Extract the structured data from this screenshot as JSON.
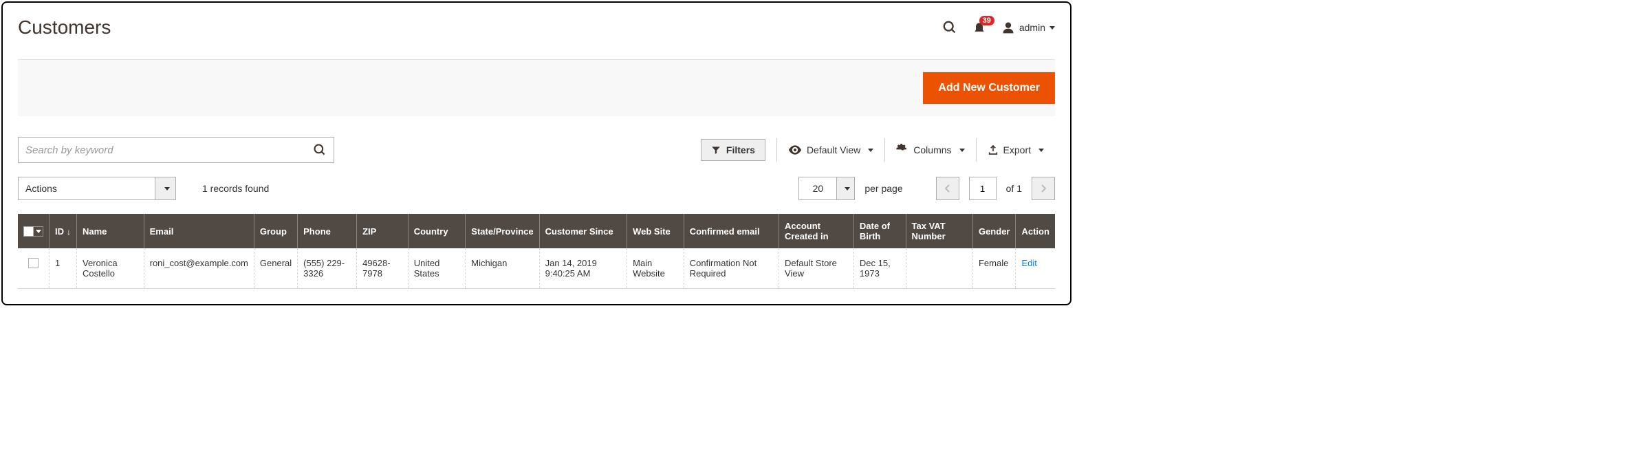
{
  "page": {
    "title": "Customers",
    "user_name": "admin",
    "notification_count": "39"
  },
  "toolbar": {
    "add_new_label": "Add New Customer"
  },
  "search": {
    "placeholder": "Search by keyword"
  },
  "controls": {
    "filters_label": "Filters",
    "default_view_label": "Default View",
    "columns_label": "Columns",
    "export_label": "Export"
  },
  "listing": {
    "actions_label": "Actions",
    "records_found": "1 records found",
    "page_size": "20",
    "per_page_label": "per page",
    "current_page": "1",
    "total_pages_label": "of 1"
  },
  "columns": {
    "id": "ID",
    "name": "Name",
    "email": "Email",
    "group": "Group",
    "phone": "Phone",
    "zip": "ZIP",
    "country": "Country",
    "state": "State/Province",
    "since": "Customer Since",
    "website": "Web Site",
    "confirmed": "Confirmed email",
    "created_in": "Account Created in",
    "dob": "Date of Birth",
    "vat": "Tax VAT Number",
    "gender": "Gender",
    "action": "Action"
  },
  "rows": [
    {
      "id": "1",
      "name": "Veronica Costello",
      "email": "roni_cost@example.com",
      "group": "General",
      "phone": "(555) 229-3326",
      "zip": "49628-7978",
      "country": "United States",
      "state": "Michigan",
      "since": "Jan 14, 2019 9:40:25 AM",
      "website": "Main Website",
      "confirmed": "Confirmation Not Required",
      "created_in": "Default Store View",
      "dob": "Dec 15, 1973",
      "vat": "",
      "gender": "Female",
      "action": "Edit"
    }
  ]
}
